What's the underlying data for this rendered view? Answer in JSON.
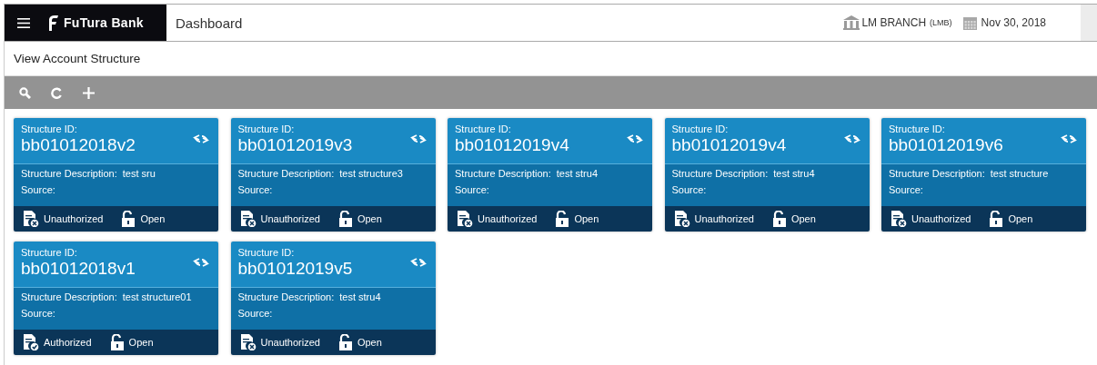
{
  "header": {
    "brand": "FuTura Bank",
    "title": "Dashboard",
    "branch": "LM BRANCH",
    "branch_code": "(LMB)",
    "date": "Nov 30, 2018"
  },
  "page_title": "View Account Structure",
  "cards": [
    {
      "id_label": "Structure ID:",
      "id": "bb01012018v2",
      "description_label": "Structure Description:",
      "description": "test sru",
      "source_label": "Source:",
      "auth": {
        "kind": "unauthorized",
        "label": "Unauthorized"
      },
      "lock": {
        "kind": "open",
        "label": "Open"
      }
    },
    {
      "id_label": "Structure ID:",
      "id": "bb01012019v3",
      "description_label": "Structure Description:",
      "description": "test structure3",
      "source_label": "Source:",
      "auth": {
        "kind": "unauthorized",
        "label": "Unauthorized"
      },
      "lock": {
        "kind": "open",
        "label": "Open"
      }
    },
    {
      "id_label": "Structure ID:",
      "id": "bb01012019v4",
      "description_label": "Structure Description:",
      "description": "test stru4",
      "source_label": "Source:",
      "auth": {
        "kind": "unauthorized",
        "label": "Unauthorized"
      },
      "lock": {
        "kind": "open",
        "label": "Open"
      }
    },
    {
      "id_label": "Structure ID:",
      "id": "bb01012019v4",
      "description_label": "Structure Description:",
      "description": "test stru4",
      "source_label": "Source:",
      "auth": {
        "kind": "unauthorized",
        "label": "Unauthorized"
      },
      "lock": {
        "kind": "open",
        "label": "Open"
      }
    },
    {
      "id_label": "Structure ID:",
      "id": "bb01012019v6",
      "description_label": "Structure Description:",
      "description": "test structure",
      "source_label": "Source:",
      "auth": {
        "kind": "unauthorized",
        "label": "Unauthorized"
      },
      "lock": {
        "kind": "open",
        "label": "Open"
      }
    },
    {
      "id_label": "Structure ID:",
      "id": "bb01012018v1",
      "description_label": "Structure Description:",
      "description": "test structure01",
      "source_label": "Source:",
      "auth": {
        "kind": "authorized",
        "label": "Authorized"
      },
      "lock": {
        "kind": "open",
        "label": "Open"
      }
    },
    {
      "id_label": "Structure ID:",
      "id": "bb01012019v5",
      "description_label": "Structure Description:",
      "description": "test stru4",
      "source_label": "Source:",
      "auth": {
        "kind": "unauthorized",
        "label": "Unauthorized"
      },
      "lock": {
        "kind": "open",
        "label": "Open"
      }
    }
  ]
}
